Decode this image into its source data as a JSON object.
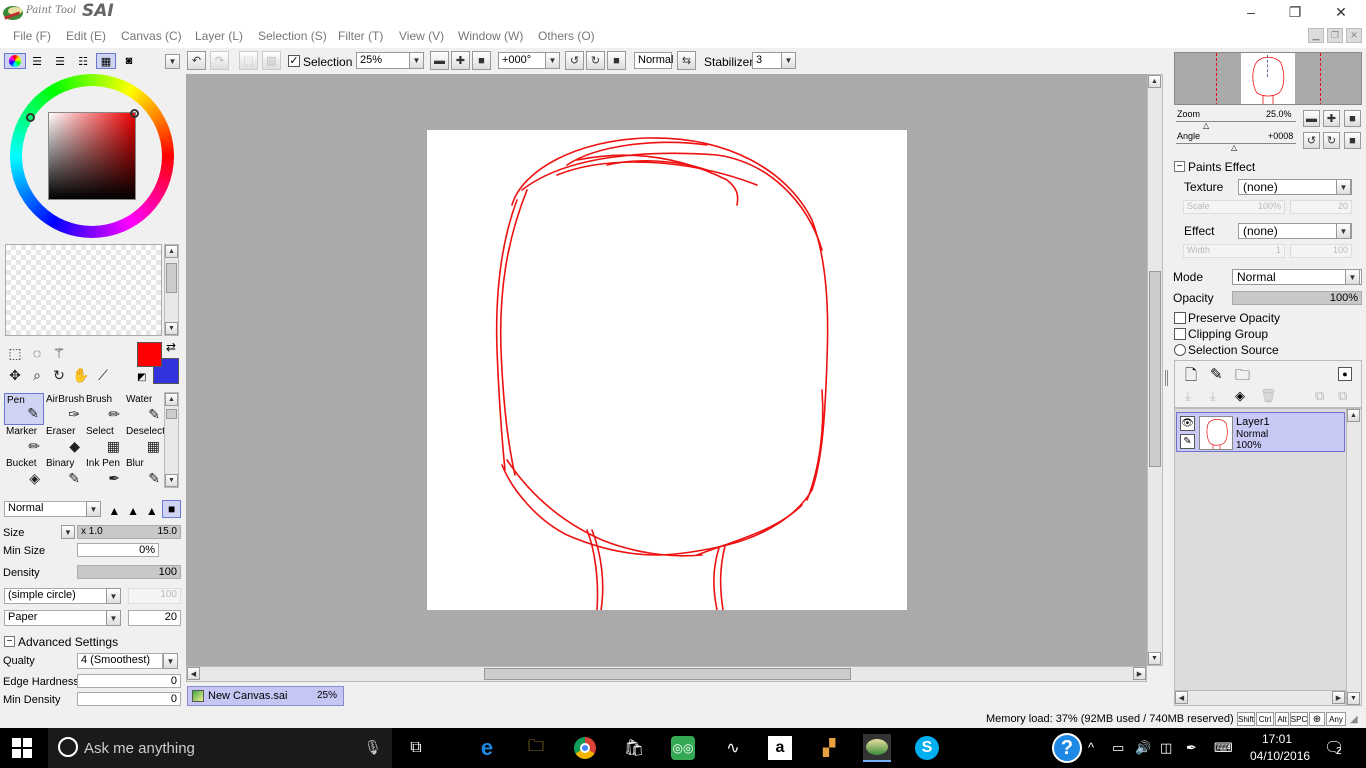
{
  "app": {
    "logo_small": "Paint Tool",
    "logo_big": "SAI"
  },
  "window_controls": {
    "minimize": "–",
    "maximize": "❐",
    "close": "✕"
  },
  "menu": [
    "File (F)",
    "Edit (E)",
    "Canvas (C)",
    "Layer (L)",
    "Selection (S)",
    "Filter (T)",
    "View (V)",
    "Window (W)",
    "Others (O)"
  ],
  "toolbar": {
    "selection_label": "Selection",
    "selection_checked": true,
    "zoom": "25%",
    "angle": "+000°",
    "blend": "Normal",
    "stabilizer_label": "Stabilizer",
    "stabilizer": "3"
  },
  "color": {
    "primary": "#ff0000",
    "secondary": "#3333dd"
  },
  "tools": [
    {
      "name": "Pen",
      "icon": "pen-icon",
      "glyph": "✎",
      "active": true
    },
    {
      "name": "AirBrush",
      "icon": "airbrush-icon",
      "glyph": "✑",
      "active": false
    },
    {
      "name": "Brush",
      "icon": "brush-icon",
      "glyph": "✏",
      "active": false
    },
    {
      "name": "Water",
      "icon": "water-icon",
      "glyph": "✎",
      "active": false
    },
    {
      "name": "Marker",
      "icon": "marker-icon",
      "glyph": "✏",
      "active": false
    },
    {
      "name": "Eraser",
      "icon": "eraser-icon",
      "glyph": "◆",
      "active": false
    },
    {
      "name": "Select",
      "icon": "select-brush-icon",
      "glyph": "▦",
      "active": false
    },
    {
      "name": "Deselect",
      "icon": "deselect-brush-icon",
      "glyph": "▦",
      "active": false
    },
    {
      "name": "Bucket",
      "icon": "bucket-icon",
      "glyph": "◈",
      "active": false
    },
    {
      "name": "Binary",
      "icon": "binary-pen-icon",
      "glyph": "✎",
      "active": false
    },
    {
      "name": "Ink Pen",
      "icon": "ink-pen-icon",
      "glyph": "✒",
      "active": false
    },
    {
      "name": "Blur",
      "icon": "blur-icon",
      "glyph": "✎",
      "active": false
    }
  ],
  "brush": {
    "blend": "Normal",
    "size_label": "Size",
    "size_mult": "x 1.0",
    "size": "15.0",
    "min_size_label": "Min Size",
    "min_size": "0%",
    "density_label": "Density",
    "density": "100",
    "shape": "(simple circle)",
    "shape_value": "100",
    "texture": "Paper",
    "texture_value": "20",
    "advanced_label": "Advanced Settings",
    "quality_label": "Qualty",
    "quality": "4 (Smoothest)",
    "edge_hardness_label": "Edge Hardness",
    "edge_hardness": "0",
    "min_density_label": "Min Density",
    "min_density": "0"
  },
  "document": {
    "name": "New Canvas.sai",
    "zoom": "25%"
  },
  "navigator": {
    "zoom_label": "Zoom",
    "zoom": "25.0%",
    "angle_label": "Angle",
    "angle": "+0008"
  },
  "paints_effect": {
    "header": "Paints Effect",
    "texture_label": "Texture",
    "texture": "(none)",
    "scale_label": "Scale",
    "scale": "100%",
    "scale_value": "20",
    "effect_label": "Effect",
    "effect": "(none)",
    "width_label": "Width",
    "width": "1",
    "width_value": "100"
  },
  "layer_props": {
    "mode_label": "Mode",
    "mode": "Normal",
    "opacity_label": "Opacity",
    "opacity": "100%",
    "preserve_opacity": "Preserve Opacity",
    "clipping_group": "Clipping Group",
    "selection_source": "Selection Source"
  },
  "layers": [
    {
      "name": "Layer1",
      "mode": "Normal",
      "opacity": "100%",
      "visible": true
    }
  ],
  "status": {
    "memory": "Memory load: 37% (92MB used / 740MB reserved)",
    "keys": [
      "Shift",
      "Ctrl",
      "Alt",
      "SPC",
      "⊕",
      "Any"
    ]
  },
  "taskbar": {
    "search_placeholder": "Ask me anything",
    "time": "17:01",
    "date": "04/10/2016",
    "notifications": "2",
    "apps": [
      "task-view-icon",
      "edge-icon",
      "file-explorer-icon",
      "chrome-icon",
      "store-icon",
      "tripadvisor-icon",
      "app-swirl-icon",
      "amazon-icon",
      "photo-editor-icon",
      "paint-tool-sai-icon",
      "skype-icon"
    ]
  }
}
